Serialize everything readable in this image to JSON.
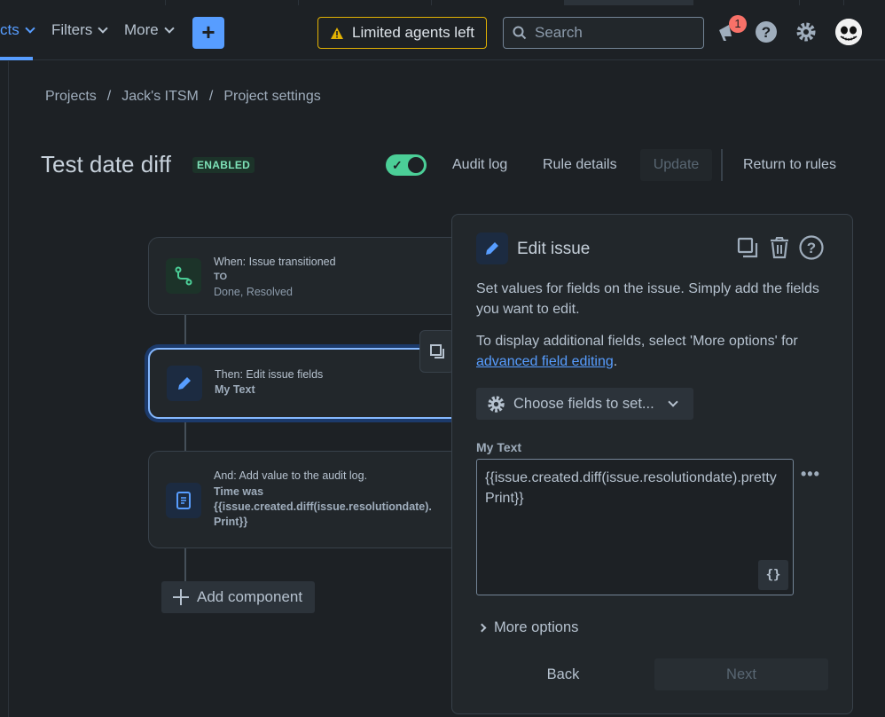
{
  "topnav": {
    "projects_label": "cts",
    "filters_label": "Filters",
    "more_label": "More",
    "create_label": "+",
    "warning_text": "Limited agents left",
    "search_placeholder": "Search",
    "notification_count": "1"
  },
  "breadcrumb": {
    "items": [
      "Projects",
      "Jack's ITSM",
      "Project settings"
    ],
    "separator": "/"
  },
  "rule": {
    "title": "Test date diff",
    "status": "ENABLED",
    "enabled": true,
    "audit_log": "Audit log",
    "rule_details": "Rule details",
    "update": "Update",
    "return": "Return to rules"
  },
  "flow": {
    "trigger": {
      "line1": "When: Issue transitioned",
      "line2": "TO",
      "line3": "Done, Resolved"
    },
    "action": {
      "line1": "Then: Edit issue fields",
      "line2": "My Text"
    },
    "audit": {
      "line1": "And: Add value to the audit log.",
      "line2": "Time was",
      "line3": "{{issue.created.diff(issue.resolutiondate).",
      "line4": "Print}}"
    },
    "add_component": "Add component"
  },
  "panel": {
    "title": "Edit issue",
    "desc1": "Set values for fields on the issue. Simply add the fields you want to edit.",
    "desc2_prefix": "To display additional fields, select 'More options' for",
    "desc2_link": "advanced field editing",
    "desc2_suffix": ".",
    "choose_fields": "Choose fields to set...",
    "field_label": "My Text",
    "field_value": "{{issue.created.diff(issue.resolutiondate).prettyPrint}}",
    "smart_values_btn": "{}",
    "more_dots": "•••",
    "more_options": "More options",
    "back": "Back",
    "next": "Next"
  },
  "colors": {
    "accent": "#579dff",
    "enabled_green": "#4bce97",
    "warning_yellow": "#e2b203",
    "badge_red": "#f87168"
  }
}
